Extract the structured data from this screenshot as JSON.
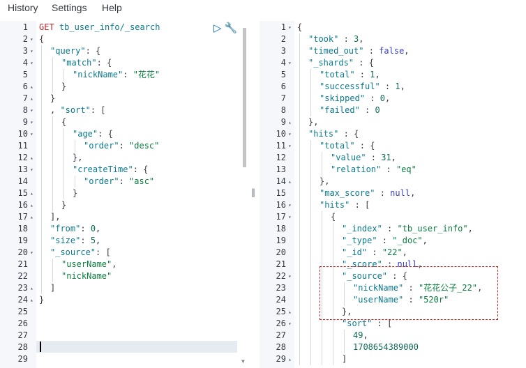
{
  "menu": {
    "items": [
      "History",
      "Settings",
      "Help"
    ]
  },
  "request": {
    "method": "GET",
    "url": "tb_user_info/_search",
    "lines": [
      {
        "n": "1",
        "fold": "",
        "indent": 0,
        "tokens": [
          [
            "method",
            "GET"
          ],
          [
            "punc",
            " "
          ],
          [
            "url",
            "tb_user_info/_search"
          ]
        ]
      },
      {
        "n": "2",
        "fold": "▾",
        "indent": 0,
        "tokens": [
          [
            "punc",
            "{"
          ]
        ]
      },
      {
        "n": "3",
        "fold": "▾",
        "indent": 1,
        "tokens": [
          [
            "key",
            "\"query\""
          ],
          [
            "punc",
            ": {"
          ]
        ]
      },
      {
        "n": "4",
        "fold": "▾",
        "indent": 2,
        "tokens": [
          [
            "key",
            "\"match\""
          ],
          [
            "punc",
            ": {"
          ]
        ]
      },
      {
        "n": "5",
        "fold": "",
        "indent": 3,
        "tokens": [
          [
            "key",
            "\"nickName\""
          ],
          [
            "punc",
            ": "
          ],
          [
            "str",
            "\"花花\""
          ]
        ]
      },
      {
        "n": "6",
        "fold": "▴",
        "indent": 2,
        "tokens": [
          [
            "punc",
            "}"
          ]
        ]
      },
      {
        "n": "7",
        "fold": "▴",
        "indent": 1,
        "tokens": [
          [
            "punc",
            "}"
          ]
        ]
      },
      {
        "n": "8",
        "fold": "▾",
        "indent": 1,
        "tokens": [
          [
            "punc",
            ", "
          ],
          [
            "key",
            "\"sort\""
          ],
          [
            "punc",
            ": ["
          ]
        ]
      },
      {
        "n": "9",
        "fold": "▾",
        "indent": 2,
        "tokens": [
          [
            "punc",
            "{"
          ]
        ]
      },
      {
        "n": "10",
        "fold": "▾",
        "indent": 3,
        "tokens": [
          [
            "key",
            "\"age\""
          ],
          [
            "punc",
            ": {"
          ]
        ]
      },
      {
        "n": "11",
        "fold": "",
        "indent": 4,
        "tokens": [
          [
            "key",
            "\"order\""
          ],
          [
            "punc",
            ": "
          ],
          [
            "str",
            "\"desc\""
          ]
        ]
      },
      {
        "n": "12",
        "fold": "▴",
        "indent": 3,
        "tokens": [
          [
            "punc",
            "},"
          ]
        ]
      },
      {
        "n": "13",
        "fold": "▾",
        "indent": 3,
        "tokens": [
          [
            "key",
            "\"createTime\""
          ],
          [
            "punc",
            ": {"
          ]
        ]
      },
      {
        "n": "14",
        "fold": "",
        "indent": 4,
        "tokens": [
          [
            "key",
            "\"order\""
          ],
          [
            "punc",
            ": "
          ],
          [
            "str",
            "\"asc\""
          ]
        ]
      },
      {
        "n": "15",
        "fold": "▴",
        "indent": 3,
        "tokens": [
          [
            "punc",
            "}"
          ]
        ]
      },
      {
        "n": "16",
        "fold": "▴",
        "indent": 2,
        "tokens": [
          [
            "punc",
            "}"
          ]
        ]
      },
      {
        "n": "17",
        "fold": "▴",
        "indent": 1,
        "tokens": [
          [
            "punc",
            "],"
          ]
        ]
      },
      {
        "n": "18",
        "fold": "",
        "indent": 1,
        "tokens": [
          [
            "key",
            "\"from\""
          ],
          [
            "punc",
            ": "
          ],
          [
            "num",
            "0"
          ],
          [
            "punc",
            ","
          ]
        ]
      },
      {
        "n": "19",
        "fold": "",
        "indent": 1,
        "tokens": [
          [
            "key",
            "\"size\""
          ],
          [
            "punc",
            ": "
          ],
          [
            "num",
            "5"
          ],
          [
            "punc",
            ","
          ]
        ]
      },
      {
        "n": "20",
        "fold": "▾",
        "indent": 1,
        "tokens": [
          [
            "key",
            "\"_source\""
          ],
          [
            "punc",
            ": ["
          ]
        ]
      },
      {
        "n": "21",
        "fold": "",
        "indent": 2,
        "tokens": [
          [
            "str",
            "\"userName\""
          ],
          [
            "punc",
            ","
          ]
        ]
      },
      {
        "n": "22",
        "fold": "",
        "indent": 2,
        "tokens": [
          [
            "str",
            "\"nickName\""
          ]
        ]
      },
      {
        "n": "23",
        "fold": "▴",
        "indent": 1,
        "tokens": [
          [
            "punc",
            "]"
          ]
        ]
      },
      {
        "n": "24",
        "fold": "▴",
        "indent": 0,
        "tokens": [
          [
            "punc",
            "}"
          ]
        ]
      },
      {
        "n": "25",
        "fold": "",
        "indent": 0,
        "tokens": []
      },
      {
        "n": "26",
        "fold": "",
        "indent": 0,
        "tokens": []
      },
      {
        "n": "27",
        "fold": "",
        "indent": 0,
        "tokens": []
      },
      {
        "n": "28",
        "fold": "",
        "indent": 0,
        "tokens": []
      },
      {
        "n": "29",
        "fold": "",
        "indent": 0,
        "tokens": []
      }
    ]
  },
  "response": {
    "lines": [
      {
        "n": "1",
        "fold": "▾",
        "indent": 0,
        "tokens": [
          [
            "punc",
            "{"
          ]
        ]
      },
      {
        "n": "2",
        "fold": "",
        "indent": 1,
        "tokens": [
          [
            "key",
            "\"took\""
          ],
          [
            "punc",
            " : "
          ],
          [
            "num",
            "3"
          ],
          [
            "punc",
            ","
          ]
        ]
      },
      {
        "n": "3",
        "fold": "",
        "indent": 1,
        "tokens": [
          [
            "key",
            "\"timed_out\""
          ],
          [
            "punc",
            " : "
          ],
          [
            "bool",
            "false"
          ],
          [
            "punc",
            ","
          ]
        ]
      },
      {
        "n": "4",
        "fold": "▾",
        "indent": 1,
        "tokens": [
          [
            "key",
            "\"_shards\""
          ],
          [
            "punc",
            " : {"
          ]
        ]
      },
      {
        "n": "5",
        "fold": "",
        "indent": 2,
        "tokens": [
          [
            "key",
            "\"total\""
          ],
          [
            "punc",
            " : "
          ],
          [
            "num",
            "1"
          ],
          [
            "punc",
            ","
          ]
        ]
      },
      {
        "n": "6",
        "fold": "",
        "indent": 2,
        "tokens": [
          [
            "key",
            "\"successful\""
          ],
          [
            "punc",
            " : "
          ],
          [
            "num",
            "1"
          ],
          [
            "punc",
            ","
          ]
        ]
      },
      {
        "n": "7",
        "fold": "",
        "indent": 2,
        "tokens": [
          [
            "key",
            "\"skipped\""
          ],
          [
            "punc",
            " : "
          ],
          [
            "num",
            "0"
          ],
          [
            "punc",
            ","
          ]
        ]
      },
      {
        "n": "8",
        "fold": "",
        "indent": 2,
        "tokens": [
          [
            "key",
            "\"failed\""
          ],
          [
            "punc",
            " : "
          ],
          [
            "num",
            "0"
          ]
        ]
      },
      {
        "n": "9",
        "fold": "▴",
        "indent": 1,
        "tokens": [
          [
            "punc",
            "},"
          ]
        ]
      },
      {
        "n": "10",
        "fold": "▾",
        "indent": 1,
        "tokens": [
          [
            "key",
            "\"hits\""
          ],
          [
            "punc",
            " : {"
          ]
        ]
      },
      {
        "n": "11",
        "fold": "▾",
        "indent": 2,
        "tokens": [
          [
            "key",
            "\"total\""
          ],
          [
            "punc",
            " : {"
          ]
        ]
      },
      {
        "n": "12",
        "fold": "",
        "indent": 3,
        "tokens": [
          [
            "key",
            "\"value\""
          ],
          [
            "punc",
            " : "
          ],
          [
            "num",
            "31"
          ],
          [
            "punc",
            ","
          ]
        ]
      },
      {
        "n": "13",
        "fold": "",
        "indent": 3,
        "tokens": [
          [
            "key",
            "\"relation\""
          ],
          [
            "punc",
            " : "
          ],
          [
            "str",
            "\"eq\""
          ]
        ]
      },
      {
        "n": "14",
        "fold": "▴",
        "indent": 2,
        "tokens": [
          [
            "punc",
            "},"
          ]
        ]
      },
      {
        "n": "15",
        "fold": "",
        "indent": 2,
        "tokens": [
          [
            "key",
            "\"max_score\""
          ],
          [
            "punc",
            " : "
          ],
          [
            "null",
            "null"
          ],
          [
            "punc",
            ","
          ]
        ]
      },
      {
        "n": "16",
        "fold": "▾",
        "indent": 2,
        "tokens": [
          [
            "key",
            "\"hits\""
          ],
          [
            "punc",
            " : ["
          ]
        ]
      },
      {
        "n": "17",
        "fold": "▾",
        "indent": 3,
        "tokens": [
          [
            "punc",
            "{"
          ]
        ]
      },
      {
        "n": "18",
        "fold": "",
        "indent": 4,
        "tokens": [
          [
            "key",
            "\"_index\""
          ],
          [
            "punc",
            " : "
          ],
          [
            "str",
            "\"tb_user_info\""
          ],
          [
            "punc",
            ","
          ]
        ]
      },
      {
        "n": "19",
        "fold": "",
        "indent": 4,
        "tokens": [
          [
            "key",
            "\"_type\""
          ],
          [
            "punc",
            " : "
          ],
          [
            "str",
            "\"_doc\""
          ],
          [
            "punc",
            ","
          ]
        ]
      },
      {
        "n": "20",
        "fold": "",
        "indent": 4,
        "tokens": [
          [
            "key",
            "\"_id\""
          ],
          [
            "punc",
            " : "
          ],
          [
            "str",
            "\"22\""
          ],
          [
            "punc",
            ","
          ]
        ]
      },
      {
        "n": "21",
        "fold": "",
        "indent": 4,
        "tokens": [
          [
            "key",
            "\"_score\""
          ],
          [
            "punc",
            " : "
          ],
          [
            "null",
            "null"
          ],
          [
            "punc",
            ","
          ]
        ]
      },
      {
        "n": "22",
        "fold": "▾",
        "indent": 4,
        "tokens": [
          [
            "key",
            "\"_source\""
          ],
          [
            "punc",
            " : {"
          ]
        ]
      },
      {
        "n": "23",
        "fold": "",
        "indent": 5,
        "tokens": [
          [
            "key",
            "\"nickName\""
          ],
          [
            "punc",
            " : "
          ],
          [
            "str",
            "\"花花公子_22\""
          ],
          [
            "punc",
            ","
          ]
        ]
      },
      {
        "n": "24",
        "fold": "",
        "indent": 5,
        "tokens": [
          [
            "key",
            "\"userName\""
          ],
          [
            "punc",
            " : "
          ],
          [
            "str",
            "\"520r\""
          ]
        ]
      },
      {
        "n": "25",
        "fold": "▴",
        "indent": 4,
        "tokens": [
          [
            "punc",
            "},"
          ]
        ]
      },
      {
        "n": "26",
        "fold": "▾",
        "indent": 4,
        "tokens": [
          [
            "key",
            "\"sort\""
          ],
          [
            "punc",
            " : ["
          ]
        ]
      },
      {
        "n": "27",
        "fold": "",
        "indent": 5,
        "tokens": [
          [
            "num",
            "49"
          ],
          [
            "punc",
            ","
          ]
        ]
      },
      {
        "n": "28",
        "fold": "",
        "indent": 5,
        "tokens": [
          [
            "num",
            "1708654389000"
          ]
        ]
      },
      {
        "n": "29",
        "fold": "▴",
        "indent": 4,
        "tokens": [
          [
            "punc",
            "]"
          ]
        ]
      }
    ]
  },
  "icons": {
    "run": "play-icon",
    "settings": "wrench-icon"
  }
}
